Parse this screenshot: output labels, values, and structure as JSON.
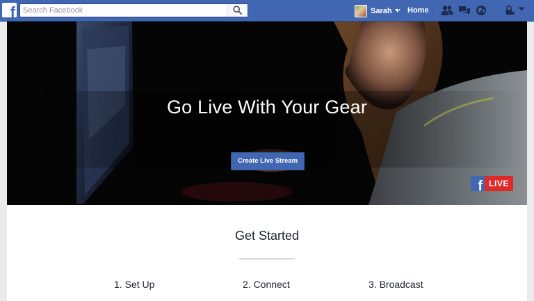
{
  "topbar": {
    "logo": "f",
    "search_placeholder": "Search Facebook",
    "user_name": "Sarah",
    "home_label": "Home",
    "icons": [
      "friend-requests-icon",
      "messages-icon",
      "notifications-globe-icon",
      "privacy-lock-icon",
      "account-menu-caret-icon"
    ],
    "brand_color": "#4267b2"
  },
  "hero": {
    "title": "Go Live With Your Gear",
    "cta_label": "Create Live Stream",
    "badge_logo": "f",
    "badge_text": "LIVE",
    "badge_color": "#e02a2a"
  },
  "get_started": {
    "heading": "Get Started",
    "steps": [
      "1. Set Up",
      "2. Connect",
      "3. Broadcast"
    ]
  }
}
